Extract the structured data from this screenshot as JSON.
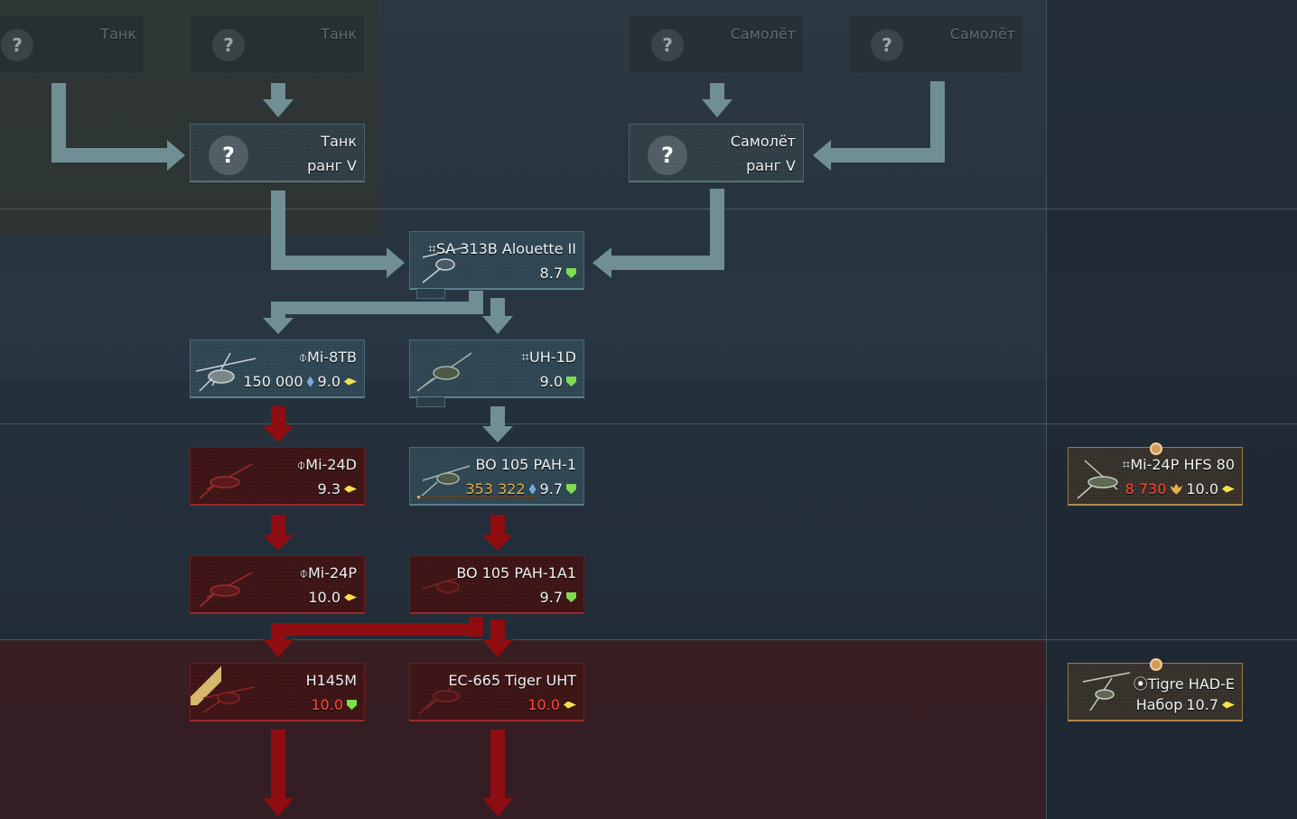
{
  "colors": {
    "accent_red": "#ff4a3a",
    "arrow_teal": "#6f8f95",
    "arrow_red": "#8f0d10",
    "br_green": "#7fdc4f",
    "br_yellow": "#f3e14a",
    "gold": "#e2b04a"
  },
  "prerequisites": {
    "ghost_1": {
      "label": "Танк",
      "icon": "question-icon"
    },
    "ghost_2": {
      "label": "Танк",
      "icon": "question-icon"
    },
    "ghost_3": {
      "label": "Самолёт",
      "icon": "question-icon"
    },
    "ghost_4": {
      "label": "Самолёт",
      "icon": "question-icon"
    },
    "tank_rank": {
      "line1": "Танк",
      "line2": "ранг V",
      "icon": "question-icon"
    },
    "plane_rank": {
      "line1": "Самолёт",
      "line2": "ранг V",
      "icon": "question-icon"
    }
  },
  "vehicles": {
    "alouette": {
      "flag": "⌗",
      "name": "SA 313B Alouette II",
      "br": "8.7",
      "br_icon": "green-shield"
    },
    "mi8tb": {
      "flag": "⌽",
      "name": "Mi-8TB",
      "cost": "150 000",
      "cost_icon": "research-point-icon",
      "br": "9.0",
      "br_icon": "yellow-arrow"
    },
    "uh1d": {
      "flag": "⌗",
      "name": "UH-1D",
      "br": "9.0",
      "br_icon": "green-shield"
    },
    "mi24d": {
      "flag": "⌽",
      "name": "Mi-24D",
      "br": "9.3",
      "br_icon": "yellow-arrow"
    },
    "bo105pah1": {
      "name": "BO 105 PAH-1",
      "cost": "353 322",
      "cost_icon": "research-point-icon",
      "br": "9.7",
      "br_icon": "green-shield",
      "research_progress": 0.02
    },
    "mi24p": {
      "flag": "⌽",
      "name": "Mi-24P",
      "br": "10.0",
      "br_icon": "yellow-arrow"
    },
    "bo105pah1a1": {
      "name": "BO 105 PAH-1A1",
      "br": "9.7",
      "br_icon": "green-shield"
    },
    "h145m": {
      "name": "H145M",
      "br": "10.0",
      "br_icon": "green-shield"
    },
    "ec665": {
      "name": "EC-665 Tiger UHT",
      "br": "10.0",
      "br_icon": "yellow-arrow"
    },
    "mi24p_hfs": {
      "flag": "⌗",
      "name": "Mi-24P HFS 80",
      "cost": "8 730",
      "cost_icon": "golden-eagle-icon",
      "br": "10.0",
      "br_icon": "yellow-arrow"
    },
    "tigre": {
      "flag": "⦿",
      "name": "Tigre HAD-E",
      "pack_label": "Набор",
      "br": "10.7",
      "br_icon": "yellow-arrow"
    }
  }
}
